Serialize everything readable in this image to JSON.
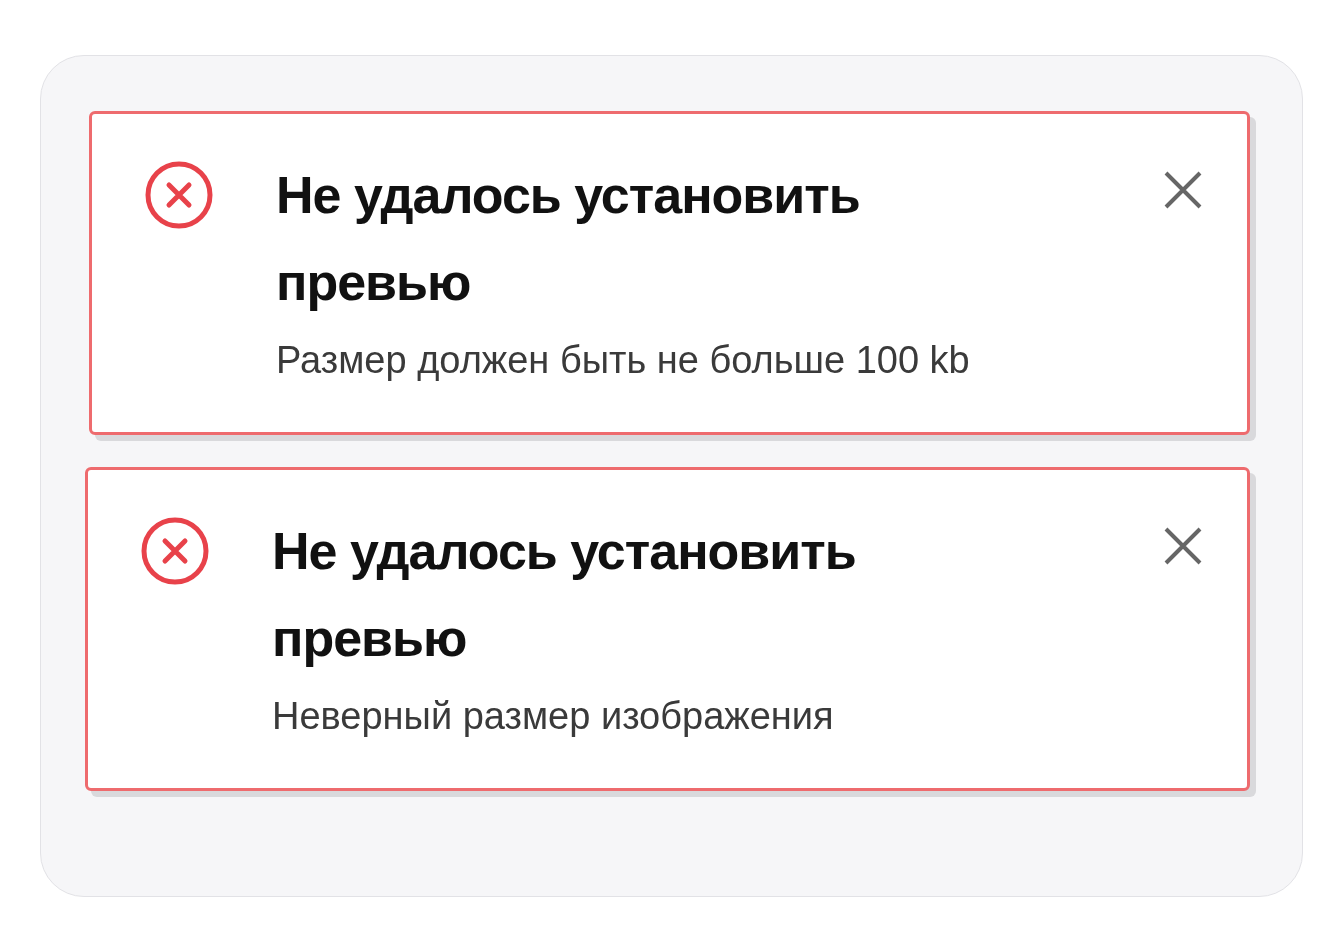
{
  "toasts": [
    {
      "title": "Не удалось установить превью",
      "message": "Размер должен быть не больше 100 kb"
    },
    {
      "title": "Не удалось установить превью",
      "message": "Неверный размер изображения"
    }
  ]
}
